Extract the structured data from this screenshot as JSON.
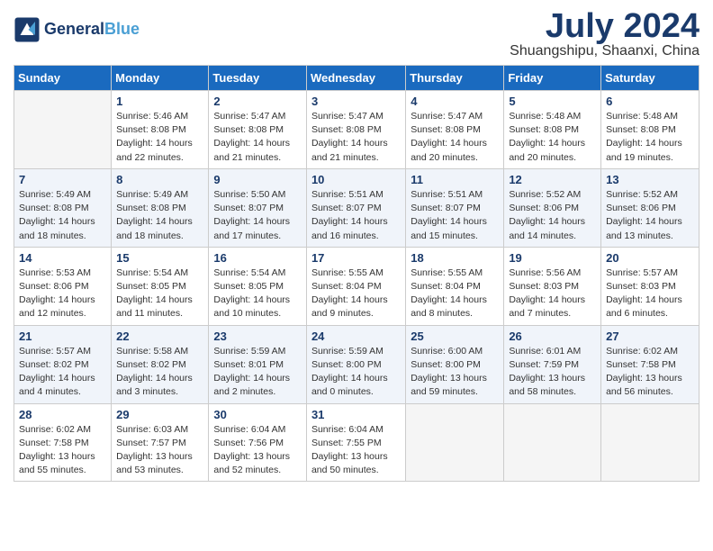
{
  "header": {
    "logo_line1": "General",
    "logo_line2": "Blue",
    "month_title": "July 2024",
    "location": "Shuangshipu, Shaanxi, China"
  },
  "days_of_week": [
    "Sunday",
    "Monday",
    "Tuesday",
    "Wednesday",
    "Thursday",
    "Friday",
    "Saturday"
  ],
  "weeks": [
    [
      {
        "day": "",
        "empty": true
      },
      {
        "day": "1",
        "sunrise": "Sunrise: 5:46 AM",
        "sunset": "Sunset: 8:08 PM",
        "daylight": "Daylight: 14 hours and 22 minutes."
      },
      {
        "day": "2",
        "sunrise": "Sunrise: 5:47 AM",
        "sunset": "Sunset: 8:08 PM",
        "daylight": "Daylight: 14 hours and 21 minutes."
      },
      {
        "day": "3",
        "sunrise": "Sunrise: 5:47 AM",
        "sunset": "Sunset: 8:08 PM",
        "daylight": "Daylight: 14 hours and 21 minutes."
      },
      {
        "day": "4",
        "sunrise": "Sunrise: 5:47 AM",
        "sunset": "Sunset: 8:08 PM",
        "daylight": "Daylight: 14 hours and 20 minutes."
      },
      {
        "day": "5",
        "sunrise": "Sunrise: 5:48 AM",
        "sunset": "Sunset: 8:08 PM",
        "daylight": "Daylight: 14 hours and 20 minutes."
      },
      {
        "day": "6",
        "sunrise": "Sunrise: 5:48 AM",
        "sunset": "Sunset: 8:08 PM",
        "daylight": "Daylight: 14 hours and 19 minutes."
      }
    ],
    [
      {
        "day": "7",
        "sunrise": "Sunrise: 5:49 AM",
        "sunset": "Sunset: 8:08 PM",
        "daylight": "Daylight: 14 hours and 18 minutes."
      },
      {
        "day": "8",
        "sunrise": "Sunrise: 5:49 AM",
        "sunset": "Sunset: 8:08 PM",
        "daylight": "Daylight: 14 hours and 18 minutes."
      },
      {
        "day": "9",
        "sunrise": "Sunrise: 5:50 AM",
        "sunset": "Sunset: 8:07 PM",
        "daylight": "Daylight: 14 hours and 17 minutes."
      },
      {
        "day": "10",
        "sunrise": "Sunrise: 5:51 AM",
        "sunset": "Sunset: 8:07 PM",
        "daylight": "Daylight: 14 hours and 16 minutes."
      },
      {
        "day": "11",
        "sunrise": "Sunrise: 5:51 AM",
        "sunset": "Sunset: 8:07 PM",
        "daylight": "Daylight: 14 hours and 15 minutes."
      },
      {
        "day": "12",
        "sunrise": "Sunrise: 5:52 AM",
        "sunset": "Sunset: 8:06 PM",
        "daylight": "Daylight: 14 hours and 14 minutes."
      },
      {
        "day": "13",
        "sunrise": "Sunrise: 5:52 AM",
        "sunset": "Sunset: 8:06 PM",
        "daylight": "Daylight: 14 hours and 13 minutes."
      }
    ],
    [
      {
        "day": "14",
        "sunrise": "Sunrise: 5:53 AM",
        "sunset": "Sunset: 8:06 PM",
        "daylight": "Daylight: 14 hours and 12 minutes."
      },
      {
        "day": "15",
        "sunrise": "Sunrise: 5:54 AM",
        "sunset": "Sunset: 8:05 PM",
        "daylight": "Daylight: 14 hours and 11 minutes."
      },
      {
        "day": "16",
        "sunrise": "Sunrise: 5:54 AM",
        "sunset": "Sunset: 8:05 PM",
        "daylight": "Daylight: 14 hours and 10 minutes."
      },
      {
        "day": "17",
        "sunrise": "Sunrise: 5:55 AM",
        "sunset": "Sunset: 8:04 PM",
        "daylight": "Daylight: 14 hours and 9 minutes."
      },
      {
        "day": "18",
        "sunrise": "Sunrise: 5:55 AM",
        "sunset": "Sunset: 8:04 PM",
        "daylight": "Daylight: 14 hours and 8 minutes."
      },
      {
        "day": "19",
        "sunrise": "Sunrise: 5:56 AM",
        "sunset": "Sunset: 8:03 PM",
        "daylight": "Daylight: 14 hours and 7 minutes."
      },
      {
        "day": "20",
        "sunrise": "Sunrise: 5:57 AM",
        "sunset": "Sunset: 8:03 PM",
        "daylight": "Daylight: 14 hours and 6 minutes."
      }
    ],
    [
      {
        "day": "21",
        "sunrise": "Sunrise: 5:57 AM",
        "sunset": "Sunset: 8:02 PM",
        "daylight": "Daylight: 14 hours and 4 minutes."
      },
      {
        "day": "22",
        "sunrise": "Sunrise: 5:58 AM",
        "sunset": "Sunset: 8:02 PM",
        "daylight": "Daylight: 14 hours and 3 minutes."
      },
      {
        "day": "23",
        "sunrise": "Sunrise: 5:59 AM",
        "sunset": "Sunset: 8:01 PM",
        "daylight": "Daylight: 14 hours and 2 minutes."
      },
      {
        "day": "24",
        "sunrise": "Sunrise: 5:59 AM",
        "sunset": "Sunset: 8:00 PM",
        "daylight": "Daylight: 14 hours and 0 minutes."
      },
      {
        "day": "25",
        "sunrise": "Sunrise: 6:00 AM",
        "sunset": "Sunset: 8:00 PM",
        "daylight": "Daylight: 13 hours and 59 minutes."
      },
      {
        "day": "26",
        "sunrise": "Sunrise: 6:01 AM",
        "sunset": "Sunset: 7:59 PM",
        "daylight": "Daylight: 13 hours and 58 minutes."
      },
      {
        "day": "27",
        "sunrise": "Sunrise: 6:02 AM",
        "sunset": "Sunset: 7:58 PM",
        "daylight": "Daylight: 13 hours and 56 minutes."
      }
    ],
    [
      {
        "day": "28",
        "sunrise": "Sunrise: 6:02 AM",
        "sunset": "Sunset: 7:58 PM",
        "daylight": "Daylight: 13 hours and 55 minutes."
      },
      {
        "day": "29",
        "sunrise": "Sunrise: 6:03 AM",
        "sunset": "Sunset: 7:57 PM",
        "daylight": "Daylight: 13 hours and 53 minutes."
      },
      {
        "day": "30",
        "sunrise": "Sunrise: 6:04 AM",
        "sunset": "Sunset: 7:56 PM",
        "daylight": "Daylight: 13 hours and 52 minutes."
      },
      {
        "day": "31",
        "sunrise": "Sunrise: 6:04 AM",
        "sunset": "Sunset: 7:55 PM",
        "daylight": "Daylight: 13 hours and 50 minutes."
      },
      {
        "day": "",
        "empty": true
      },
      {
        "day": "",
        "empty": true
      },
      {
        "day": "",
        "empty": true
      }
    ]
  ]
}
